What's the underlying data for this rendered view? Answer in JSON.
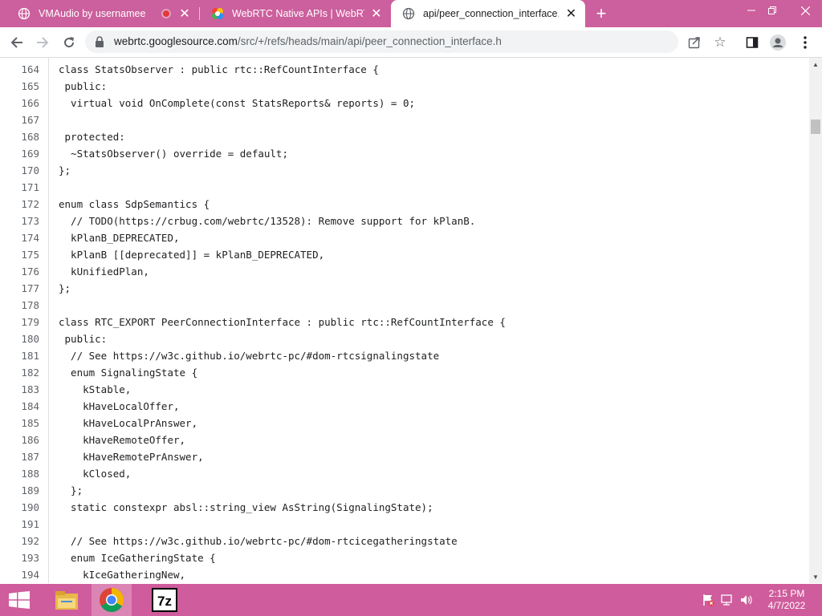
{
  "browser": {
    "tabs": [
      {
        "title": "VMAudio by usernamee",
        "favicon": "globe-icon"
      },
      {
        "title": "WebRTC Native APIs | WebRTC",
        "favicon": "webrtc-icon"
      },
      {
        "title": "api/peer_connection_interface.h",
        "favicon": "globe-icon",
        "active": true
      }
    ],
    "url_host": "webrtc.googlesource.com",
    "url_path": "/src/+/refs/heads/main/api/peer_connection_interface.h"
  },
  "code_lines": [
    {
      "n": "164",
      "text": "class StatsObserver : public rtc::RefCountInterface {"
    },
    {
      "n": "165",
      "text": " public:"
    },
    {
      "n": "166",
      "text": "  virtual void OnComplete(const StatsReports& reports) = 0;"
    },
    {
      "n": "167",
      "text": ""
    },
    {
      "n": "168",
      "text": " protected:"
    },
    {
      "n": "169",
      "text": "  ~StatsObserver() override = default;"
    },
    {
      "n": "170",
      "text": "};"
    },
    {
      "n": "171",
      "text": ""
    },
    {
      "n": "172",
      "text": "enum class SdpSemantics {"
    },
    {
      "n": "173",
      "text": "  // TODO(https://crbug.com/webrtc/13528): Remove support for kPlanB."
    },
    {
      "n": "174",
      "text": "  kPlanB_DEPRECATED,"
    },
    {
      "n": "175",
      "text": "  kPlanB [[deprecated]] = kPlanB_DEPRECATED,"
    },
    {
      "n": "176",
      "text": "  kUnifiedPlan,"
    },
    {
      "n": "177",
      "text": "};"
    },
    {
      "n": "178",
      "text": ""
    },
    {
      "n": "179",
      "text": "class RTC_EXPORT PeerConnectionInterface : public rtc::RefCountInterface {"
    },
    {
      "n": "180",
      "text": " public:"
    },
    {
      "n": "181",
      "text": "  // See https://w3c.github.io/webrtc-pc/#dom-rtcsignalingstate"
    },
    {
      "n": "182",
      "text": "  enum SignalingState {"
    },
    {
      "n": "183",
      "text": "    kStable,"
    },
    {
      "n": "184",
      "text": "    kHaveLocalOffer,"
    },
    {
      "n": "185",
      "text": "    kHaveLocalPrAnswer,"
    },
    {
      "n": "186",
      "text": "    kHaveRemoteOffer,"
    },
    {
      "n": "187",
      "text": "    kHaveRemotePrAnswer,"
    },
    {
      "n": "188",
      "text": "    kClosed,"
    },
    {
      "n": "189",
      "text": "  };"
    },
    {
      "n": "190",
      "text": "  static constexpr absl::string_view AsString(SignalingState);"
    },
    {
      "n": "191",
      "text": ""
    },
    {
      "n": "192",
      "text": "  // See https://w3c.github.io/webrtc-pc/#dom-rtcicegatheringstate"
    },
    {
      "n": "193",
      "text": "  enum IceGatheringState {"
    },
    {
      "n": "194",
      "text": "    kIceGatheringNew,"
    }
  ],
  "taskbar": {
    "time": "2:15 PM",
    "date": "4/7/2022"
  }
}
